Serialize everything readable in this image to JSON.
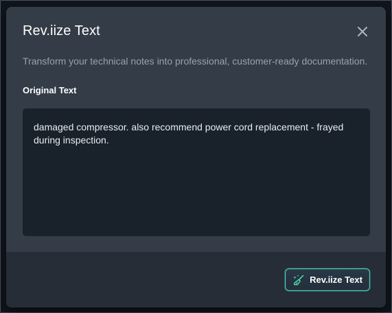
{
  "modal": {
    "title": "Rev.iize Text",
    "subtitle": "Transform your technical notes into professional, customer-ready documentation.",
    "close_icon": "close-icon",
    "field_label": "Original Text",
    "original_text": "damaged compressor. also recommend power cord replacement - frayed during inspection.",
    "submit_label": "Rev.iize Text",
    "submit_icon": "broom-sparkle-icon"
  },
  "colors": {
    "accent": "#4fd1a5",
    "modal_bg": "#343c47",
    "footer_bg": "#262d37",
    "textarea_bg": "#19212b"
  }
}
